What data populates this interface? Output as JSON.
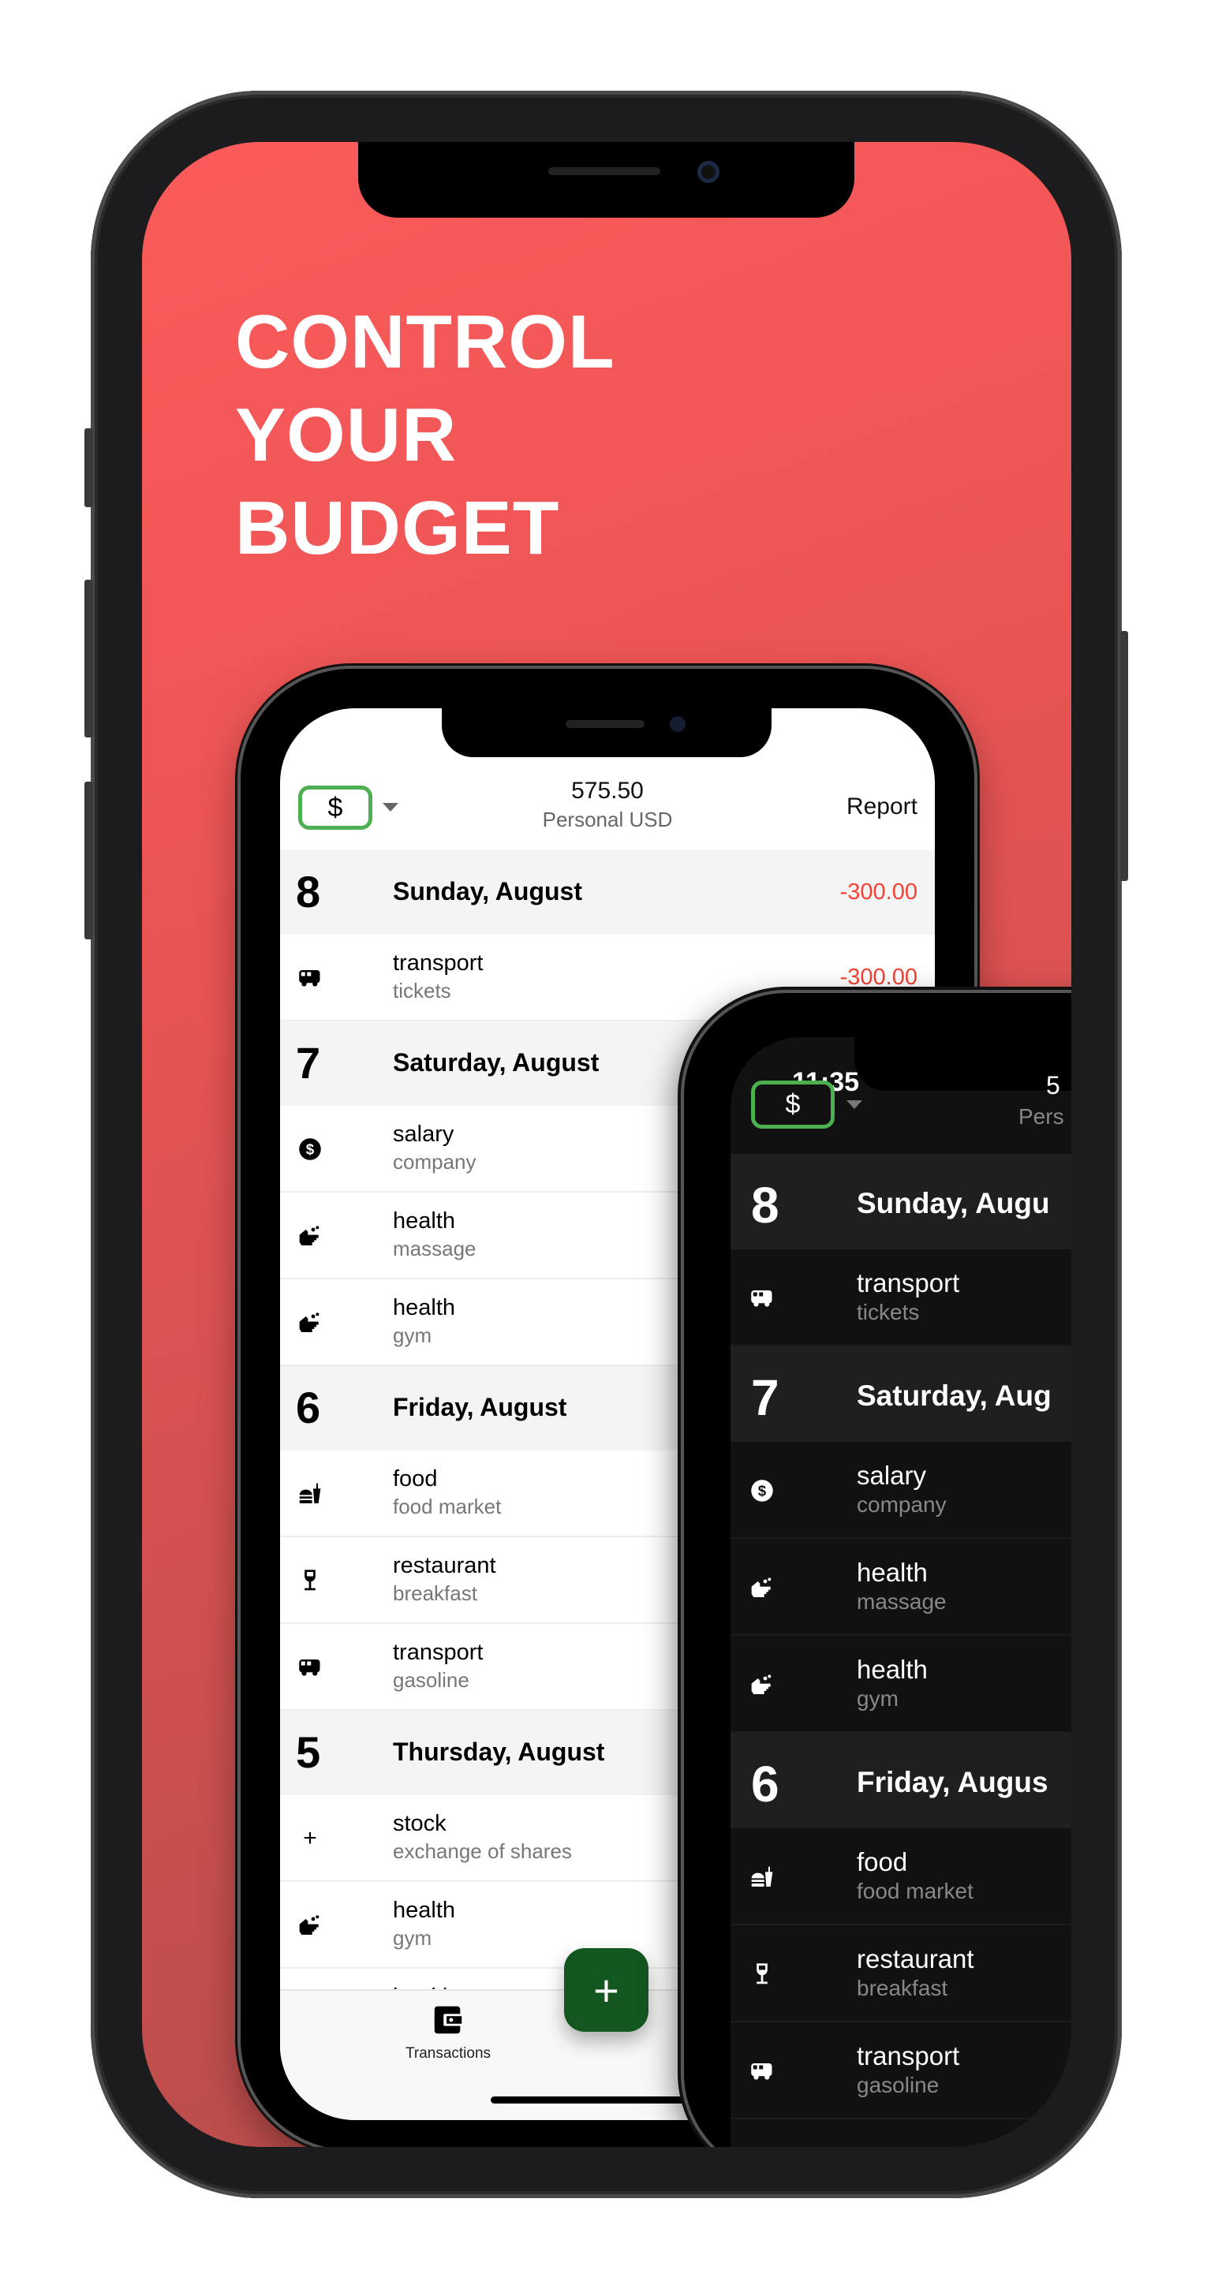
{
  "headline": [
    "CONTROL",
    "YOUR",
    "BUDGET"
  ],
  "colors": {
    "accent": "#4caf50",
    "fab": "#14561f",
    "negative": "#f44336",
    "background_top": "#fb5b5b",
    "background_bottom": "#b44c4b"
  },
  "light_app": {
    "currency_symbol": "$",
    "balance": "575.50",
    "account": "Personal USD",
    "report_label": "Report",
    "rows": [
      {
        "type": "day",
        "num": "8",
        "title": "Sunday, August",
        "amount": "-300.00"
      },
      {
        "type": "tx",
        "icon": "bus-icon",
        "cat": "transport",
        "sub": "tickets",
        "amount": "-300.00"
      },
      {
        "type": "day",
        "num": "7",
        "title": "Saturday, August"
      },
      {
        "type": "tx",
        "icon": "dollar-circle-icon",
        "cat": "salary",
        "sub": "company"
      },
      {
        "type": "tx",
        "icon": "hand-wash-icon",
        "cat": "health",
        "sub": "massage"
      },
      {
        "type": "tx",
        "icon": "hand-wash-icon",
        "cat": "health",
        "sub": "gym"
      },
      {
        "type": "day",
        "num": "6",
        "title": "Friday, August"
      },
      {
        "type": "tx",
        "icon": "fastfood-icon",
        "cat": "food",
        "sub": "food market"
      },
      {
        "type": "tx",
        "icon": "wine-glass-icon",
        "cat": "restaurant",
        "sub": "breakfast"
      },
      {
        "type": "tx",
        "icon": "bus-icon",
        "cat": "transport",
        "sub": "gasoline"
      },
      {
        "type": "day",
        "num": "5",
        "title": "Thursday, August"
      },
      {
        "type": "tx",
        "icon": "plus-icon",
        "cat": "stock",
        "sub": "exchange of shares"
      },
      {
        "type": "tx",
        "icon": "hand-wash-icon",
        "cat": "health",
        "sub": "gym"
      },
      {
        "type": "tx",
        "icon": "hand-wash-icon",
        "cat": "health",
        "sub": ""
      }
    ],
    "tab_label": "Transactions",
    "fab_label": "+"
  },
  "dark_app": {
    "time": "11:35",
    "currency_symbol": "$",
    "balance_partial": "5",
    "account_partial": "Pers",
    "rows": [
      {
        "type": "day",
        "num": "8",
        "title": "Sunday, Augu"
      },
      {
        "type": "tx",
        "icon": "bus-icon",
        "cat": "transport",
        "sub": "tickets"
      },
      {
        "type": "day",
        "num": "7",
        "title": "Saturday, Aug"
      },
      {
        "type": "tx",
        "icon": "dollar-circle-icon",
        "cat": "salary",
        "sub": "company"
      },
      {
        "type": "tx",
        "icon": "hand-wash-icon",
        "cat": "health",
        "sub": "massage"
      },
      {
        "type": "tx",
        "icon": "hand-wash-icon",
        "cat": "health",
        "sub": "gym"
      },
      {
        "type": "day",
        "num": "6",
        "title": "Friday, Augus"
      },
      {
        "type": "tx",
        "icon": "fastfood-icon",
        "cat": "food",
        "sub": "food market"
      },
      {
        "type": "tx",
        "icon": "wine-glass-icon",
        "cat": "restaurant",
        "sub": "breakfast"
      },
      {
        "type": "tx",
        "icon": "bus-icon",
        "cat": "transport",
        "sub": "gasoline"
      }
    ]
  }
}
